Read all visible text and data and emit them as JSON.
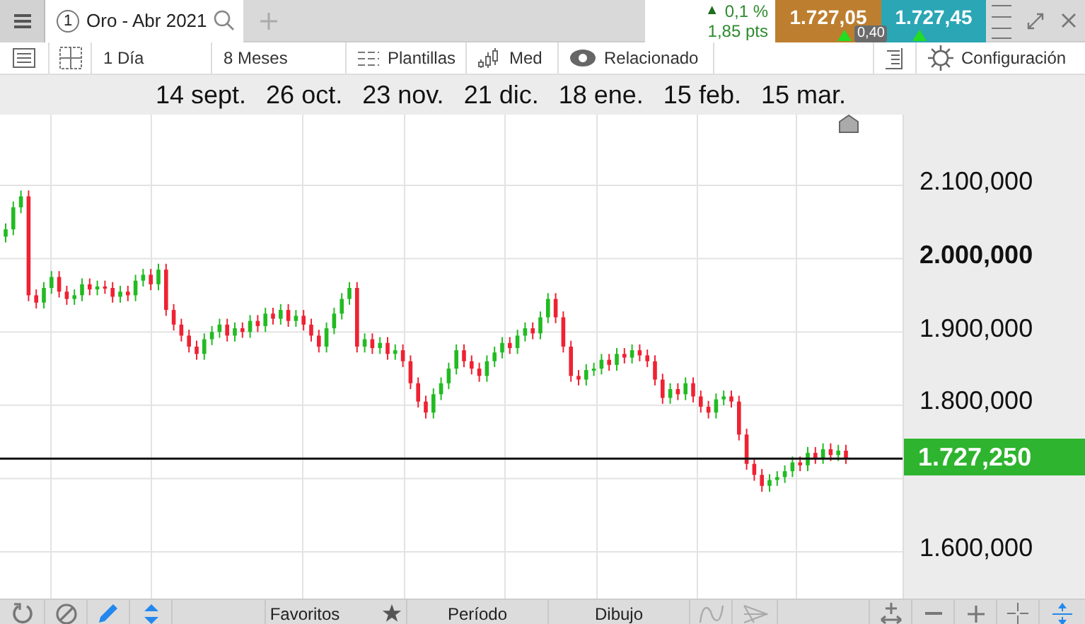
{
  "tab": {
    "number": "1",
    "title": "Oro - Abr 2021",
    "selected": true
  },
  "change": {
    "arrow": "▲",
    "percent": "0,1 %",
    "points": "1,85 pts"
  },
  "sell": {
    "price": "1.727,05"
  },
  "buy": {
    "price": "1.727,45"
  },
  "spread": "0,40",
  "toolbar": [
    {
      "kind": "icon"
    },
    {
      "kind": "icon"
    },
    {
      "kind": "text",
      "label": "1 Día"
    },
    {
      "kind": "text",
      "label": "8 Meses"
    },
    {
      "kind": "text",
      "label": "Plantillas"
    },
    {
      "kind": "text",
      "label": "Med"
    },
    {
      "kind": "text",
      "label": "Relacionado"
    },
    {
      "kind": "spacer"
    },
    {
      "kind": "icon"
    },
    {
      "kind": "text",
      "label": "Configuración"
    }
  ],
  "date_axis": [
    "14 sept.",
    "26 oct.",
    "23 nov.",
    "21 dic.",
    "18 ene.",
    "15 feb.",
    "15 mar."
  ],
  "chart": {
    "chart_data": {
      "type": "candlestick",
      "ylim": [
        1536.3,
        2196.5
      ],
      "grid": true,
      "ref_lines": [
        {
          "axis": "y",
          "value": 1727.25
        }
      ],
      "yticks": [
        {
          "value": 2100,
          "label": "2.100,000"
        },
        {
          "value": 2000,
          "label": "2.000,000"
        },
        {
          "value": 1900,
          "label": "1.900,000"
        },
        {
          "value": 1800,
          "label": "1.800,000"
        },
        {
          "value": 1600,
          "label": "1.600,000"
        }
      ],
      "categories": [
        null,
        null,
        null,
        null,
        null,
        null,
        null,
        null,
        null,
        null,
        null,
        null,
        null,
        null,
        null,
        null,
        null,
        null,
        null,
        null,
        null,
        null,
        null,
        null,
        null,
        null,
        null,
        null,
        null,
        null,
        null,
        null,
        null,
        null,
        null,
        null,
        null,
        null,
        null,
        null,
        null,
        null,
        null,
        null,
        null,
        null,
        null,
        null,
        null,
        null,
        null,
        null,
        null,
        null,
        null,
        null,
        null,
        null,
        null,
        null,
        null,
        null,
        null,
        null,
        null,
        null,
        null,
        null,
        null,
        null,
        null,
        null,
        null,
        null,
        null,
        null,
        null,
        null,
        null,
        null,
        null,
        null,
        null,
        null,
        null,
        null,
        null,
        null,
        null,
        null,
        null,
        null,
        null,
        null,
        null,
        null,
        null,
        null,
        null,
        null,
        null,
        null,
        null,
        null,
        null,
        null,
        null,
        null,
        null,
        null,
        null
      ],
      "ohlc": [
        [
          2030,
          2048,
          2022,
          2040
        ],
        [
          2040,
          2078,
          2032,
          2070
        ],
        [
          2070,
          2093,
          2062,
          2085
        ],
        [
          2085,
          2093,
          1942,
          1950
        ],
        [
          1950,
          1958,
          1932,
          1940
        ],
        [
          1940,
          1968,
          1932,
          1960
        ],
        [
          1960,
          1983,
          1952,
          1975
        ],
        [
          1975,
          1983,
          1947,
          1955
        ],
        [
          1955,
          1963,
          1937,
          1945
        ],
        [
          1945,
          1958,
          1937,
          1950
        ],
        [
          1950,
          1973,
          1942,
          1965
        ],
        [
          1965,
          1973,
          1950,
          1958
        ],
        [
          1958,
          1970,
          1950,
          1962
        ],
        [
          1962,
          1970,
          1952,
          1960
        ],
        [
          1960,
          1968,
          1940,
          1948
        ],
        [
          1948,
          1963,
          1940,
          1955
        ],
        [
          1955,
          1963,
          1942,
          1950
        ],
        [
          1950,
          1978,
          1942,
          1970
        ],
        [
          1970,
          1986,
          1962,
          1978
        ],
        [
          1978,
          1986,
          1957,
          1965
        ],
        [
          1965,
          1993,
          1957,
          1985
        ],
        [
          1985,
          1993,
          1922,
          1930
        ],
        [
          1930,
          1938,
          1902,
          1910
        ],
        [
          1910,
          1918,
          1887,
          1895
        ],
        [
          1895,
          1903,
          1872,
          1880
        ],
        [
          1880,
          1888,
          1862,
          1870
        ],
        [
          1870,
          1898,
          1862,
          1890
        ],
        [
          1890,
          1908,
          1882,
          1900
        ],
        [
          1900,
          1918,
          1892,
          1910
        ],
        [
          1910,
          1918,
          1887,
          1895
        ],
        [
          1895,
          1913,
          1887,
          1905
        ],
        [
          1905,
          1913,
          1892,
          1900
        ],
        [
          1900,
          1923,
          1892,
          1915
        ],
        [
          1915,
          1923,
          1900,
          1908
        ],
        [
          1908,
          1933,
          1900,
          1925
        ],
        [
          1925,
          1933,
          1910,
          1918
        ],
        [
          1918,
          1938,
          1910,
          1930
        ],
        [
          1930,
          1938,
          1907,
          1915
        ],
        [
          1915,
          1930,
          1907,
          1922
        ],
        [
          1922,
          1930,
          1902,
          1910
        ],
        [
          1910,
          1918,
          1887,
          1895
        ],
        [
          1895,
          1903,
          1872,
          1880
        ],
        [
          1880,
          1913,
          1872,
          1905
        ],
        [
          1905,
          1933,
          1897,
          1925
        ],
        [
          1925,
          1953,
          1917,
          1945
        ],
        [
          1945,
          1968,
          1937,
          1960
        ],
        [
          1960,
          1968,
          1872,
          1880
        ],
        [
          1880,
          1898,
          1872,
          1890
        ],
        [
          1890,
          1898,
          1870,
          1878
        ],
        [
          1878,
          1893,
          1870,
          1885
        ],
        [
          1885,
          1893,
          1862,
          1870
        ],
        [
          1870,
          1883,
          1862,
          1875
        ],
        [
          1875,
          1883,
          1852,
          1860
        ],
        [
          1860,
          1868,
          1822,
          1830
        ],
        [
          1830,
          1838,
          1797,
          1805
        ],
        [
          1805,
          1813,
          1782,
          1790
        ],
        [
          1790,
          1823,
          1782,
          1815
        ],
        [
          1815,
          1838,
          1807,
          1830
        ],
        [
          1830,
          1858,
          1822,
          1850
        ],
        [
          1850,
          1883,
          1842,
          1875
        ],
        [
          1875,
          1883,
          1852,
          1860
        ],
        [
          1860,
          1868,
          1842,
          1850
        ],
        [
          1850,
          1858,
          1832,
          1840
        ],
        [
          1840,
          1868,
          1832,
          1860
        ],
        [
          1860,
          1880,
          1852,
          1872
        ],
        [
          1872,
          1893,
          1864,
          1885
        ],
        [
          1885,
          1893,
          1870,
          1878
        ],
        [
          1878,
          1903,
          1870,
          1895
        ],
        [
          1895,
          1913,
          1887,
          1905
        ],
        [
          1905,
          1913,
          1890,
          1898
        ],
        [
          1898,
          1928,
          1890,
          1920
        ],
        [
          1920,
          1953,
          1912,
          1945
        ],
        [
          1945,
          1953,
          1912,
          1920
        ],
        [
          1920,
          1928,
          1872,
          1880
        ],
        [
          1880,
          1888,
          1832,
          1840
        ],
        [
          1840,
          1848,
          1827,
          1835
        ],
        [
          1835,
          1856,
          1827,
          1848
        ],
        [
          1848,
          1858,
          1840,
          1850
        ],
        [
          1850,
          1870,
          1842,
          1862
        ],
        [
          1862,
          1870,
          1847,
          1855
        ],
        [
          1855,
          1878,
          1847,
          1870
        ],
        [
          1870,
          1878,
          1857,
          1865
        ],
        [
          1865,
          1883,
          1857,
          1875
        ],
        [
          1875,
          1883,
          1860,
          1868
        ],
        [
          1868,
          1876,
          1852,
          1860
        ],
        [
          1860,
          1868,
          1827,
          1835
        ],
        [
          1835,
          1843,
          1802,
          1810
        ],
        [
          1810,
          1830,
          1802,
          1822
        ],
        [
          1822,
          1830,
          1807,
          1815
        ],
        [
          1815,
          1838,
          1807,
          1830
        ],
        [
          1830,
          1838,
          1804,
          1812
        ],
        [
          1812,
          1820,
          1790,
          1798
        ],
        [
          1798,
          1806,
          1782,
          1790
        ],
        [
          1790,
          1816,
          1782,
          1808
        ],
        [
          1808,
          1820,
          1800,
          1812
        ],
        [
          1812,
          1820,
          1797,
          1805
        ],
        [
          1805,
          1813,
          1752,
          1760
        ],
        [
          1760,
          1768,
          1712,
          1720
        ],
        [
          1720,
          1728,
          1697,
          1705
        ],
        [
          1705,
          1713,
          1682,
          1690
        ],
        [
          1690,
          1706,
          1682,
          1698
        ],
        [
          1698,
          1710,
          1690,
          1702
        ],
        [
          1702,
          1718,
          1694,
          1710
        ],
        [
          1710,
          1730,
          1702,
          1722
        ],
        [
          1722,
          1730,
          1710,
          1718
        ],
        [
          1718,
          1743,
          1710,
          1735
        ],
        [
          1735,
          1743,
          1720,
          1728
        ],
        [
          1728,
          1748,
          1720,
          1740
        ],
        [
          1740,
          1748,
          1724,
          1732
        ],
        [
          1732,
          1746,
          1724,
          1738
        ],
        [
          1738,
          1746,
          1720,
          1728
        ]
      ]
    },
    "current_price": "1.727,250"
  },
  "bottom_bar": [
    {
      "kind": "icon",
      "selected": false
    },
    {
      "kind": "icon",
      "selected": false
    },
    {
      "kind": "icon",
      "selected": true
    },
    {
      "kind": "icon",
      "selected": true
    },
    {
      "kind": "spacer"
    },
    {
      "kind": "text",
      "label": "Favoritos"
    },
    {
      "kind": "text",
      "label": "Período"
    },
    {
      "kind": "text",
      "label": "Dibujo"
    },
    {
      "kind": "icon",
      "selected": false
    },
    {
      "kind": "icon",
      "selected": false
    },
    {
      "kind": "spacer"
    },
    {
      "kind": "icon",
      "selected": false
    },
    {
      "kind": "icon",
      "selected": false
    },
    {
      "kind": "icon",
      "selected": false
    },
    {
      "kind": "icon",
      "selected": false
    },
    {
      "kind": "icon",
      "selected": true
    }
  ]
}
